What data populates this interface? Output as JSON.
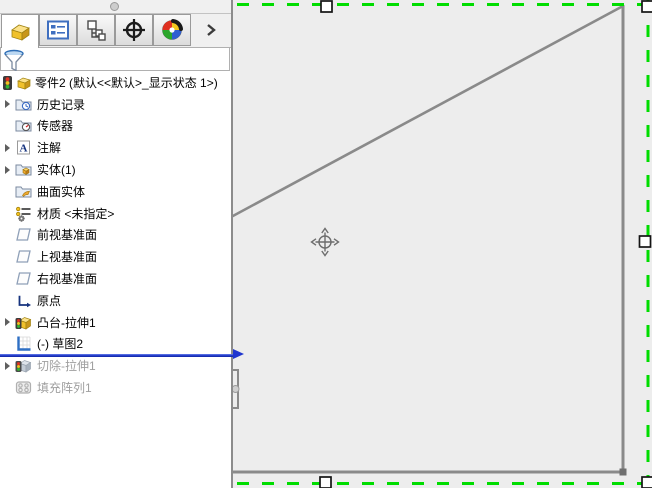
{
  "app": {
    "component": "SolidWorks FeatureManager design tree with graphics viewport"
  },
  "panel": {
    "tabs": [
      {
        "id": "features",
        "icon": "part-icon",
        "active": true
      },
      {
        "id": "property-manager",
        "icon": "property-manager-icon",
        "active": false
      },
      {
        "id": "configuration-manager",
        "icon": "configuration-manager-icon",
        "active": false
      },
      {
        "id": "dimxpert-manager",
        "icon": "dimxpert-icon",
        "active": false
      },
      {
        "id": "display-manager",
        "icon": "display-manager-icon",
        "active": false
      }
    ],
    "overflow_chevron": "›",
    "filter": {
      "icon": "filter-funnel-icon"
    },
    "tree": {
      "root_label": "零件2 (默认<<默认>_显示状态 1>)",
      "items": [
        {
          "label": "历史记录",
          "icon": "history-folder-icon",
          "expandable": true
        },
        {
          "label": "传感器",
          "icon": "sensors-folder-icon",
          "expandable": false
        },
        {
          "label": "注解",
          "icon": "annotations-icon",
          "expandable": true
        },
        {
          "label": "实体(1)",
          "icon": "solid-bodies-folder-icon",
          "expandable": true
        },
        {
          "label": "曲面实体",
          "icon": "surface-bodies-folder-icon",
          "expandable": false
        },
        {
          "label": "材质 <未指定>",
          "icon": "material-icon",
          "expandable": false
        },
        {
          "label": "前视基准面",
          "icon": "plane-icon",
          "expandable": false
        },
        {
          "label": "上视基准面",
          "icon": "plane-icon",
          "expandable": false
        },
        {
          "label": "右视基准面",
          "icon": "plane-icon",
          "expandable": false
        },
        {
          "label": "原点",
          "icon": "origin-icon",
          "expandable": false
        },
        {
          "label": "凸台-拉伸1",
          "icon": "boss-extrude-icon",
          "expandable": true
        },
        {
          "label": "(-) 草图2",
          "icon": "sketch-icon",
          "expandable": false
        },
        {
          "label": "切除-拉伸1",
          "icon": "cut-extrude-icon",
          "expandable": true,
          "suppressed": true
        },
        {
          "label": "填充阵列1",
          "icon": "fill-pattern-icon",
          "expandable": false,
          "suppressed": true
        }
      ],
      "rollback_bar_after_item": "(-) 草图2"
    }
  },
  "canvas": {
    "selection_border": "green-dashed",
    "handle_count_visible": 5,
    "sketch_entities": [
      "diagonal-line",
      "right-vertical-line",
      "bottom-horizontal-line",
      "left-edge-notch",
      "vertex-point",
      "origin-move-marker"
    ],
    "colors": {
      "selection_green": "#00dd00",
      "sketch_gray": "#8a8a8a",
      "rollback_blue": "#2036cf",
      "graphics_background": "#ededed",
      "panel_background": "#ffffff"
    }
  }
}
